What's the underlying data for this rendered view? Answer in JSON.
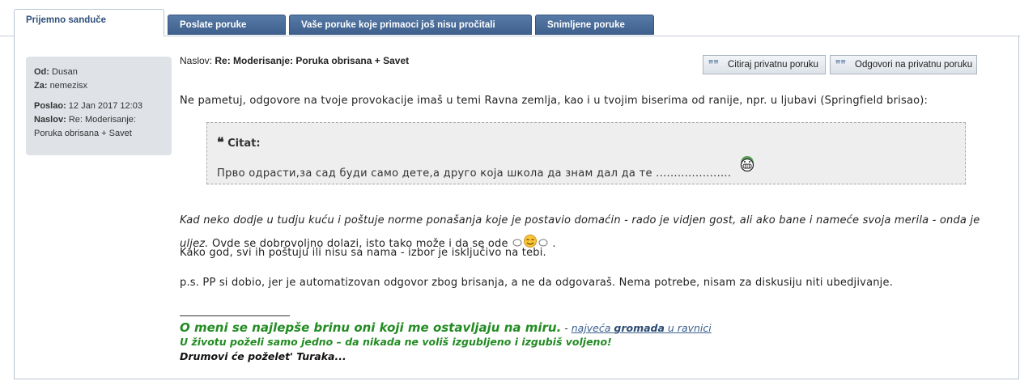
{
  "tabs": [
    {
      "label": "Prijemno sanduče"
    },
    {
      "label": "Poslate poruke"
    },
    {
      "label": "Vaše poruke koje primaoci još nisu pročitali"
    },
    {
      "label": "Snimljene poruke"
    }
  ],
  "meta": {
    "from_label": "Od:",
    "from_value": "Dusan",
    "to_label": "Za:",
    "to_value": "nemezisx",
    "sent_label": "Poslao:",
    "sent_value": "12 Jan 2017 12:03",
    "subject_label": "Naslov:",
    "subject_value_1": "Re: Moderisanje:",
    "subject_value_2": "Poruka obrisana + Savet"
  },
  "message": {
    "subject_label": "Naslov:",
    "subject": "Re: Moderisanje: Poruka obrisana + Savet",
    "quote_button": "Citiraj privatnu poruku",
    "reply_button": "Odgovori na privatnu poruku",
    "p1": "Ne pametuj, odgovore na tvoje provokacije imaš u temi Ravna zemlja, kao i u tvojim biserima od ranije, npr. u ljubavi (Springfield brisao):",
    "quote_title": "Citat:",
    "quote_text": "Прво одрасти,за сад буди само дете,а друго која школа да знам дал да те .....................",
    "p2_italic_a": "Kad neko dodje u tudju kuću i poštuje norme ponašanja koje je postavio domaćin - rado je vidjen gost, ali ako bane i nameće svoja merila - onda je",
    "p2_italic_b": "uljez.",
    "p2_rest": " Ovde se dobrovoljno dolazi, isto tako može i da se ode",
    "p2_end": ".",
    "p3": "Kako god, svi ih poštuju ili nisu sa nama - izbor je isključivo na tebi.",
    "p4": "p.s. PP si dobio, jer je automatizovan odgovor zbog brisanja, a ne da odgovaraš. Nema potrebe, nisam za diskusiju niti ubedjivanje."
  },
  "signature": {
    "line1": "O meni se najlepše brinu oni koji me ostavljaju na miru.",
    "sep": " - ",
    "link_a": "najveća ",
    "link_b": "gromada",
    "link_c": " u ravnici",
    "line2": "U životu poželi samo jedno – da nikada ne voliš izgubljeno i izgubiš voljeno!",
    "line3": "Drumovi će poželet' Turaka..."
  },
  "colors": {
    "tab": "#4a6d99",
    "signature_green": "#228b22",
    "meta_bg": "#dfe3e8"
  },
  "icons": [
    "quote-post-icon",
    "reply-post-icon",
    "grin-smiley-icon",
    "waving-smiley-icon"
  ]
}
